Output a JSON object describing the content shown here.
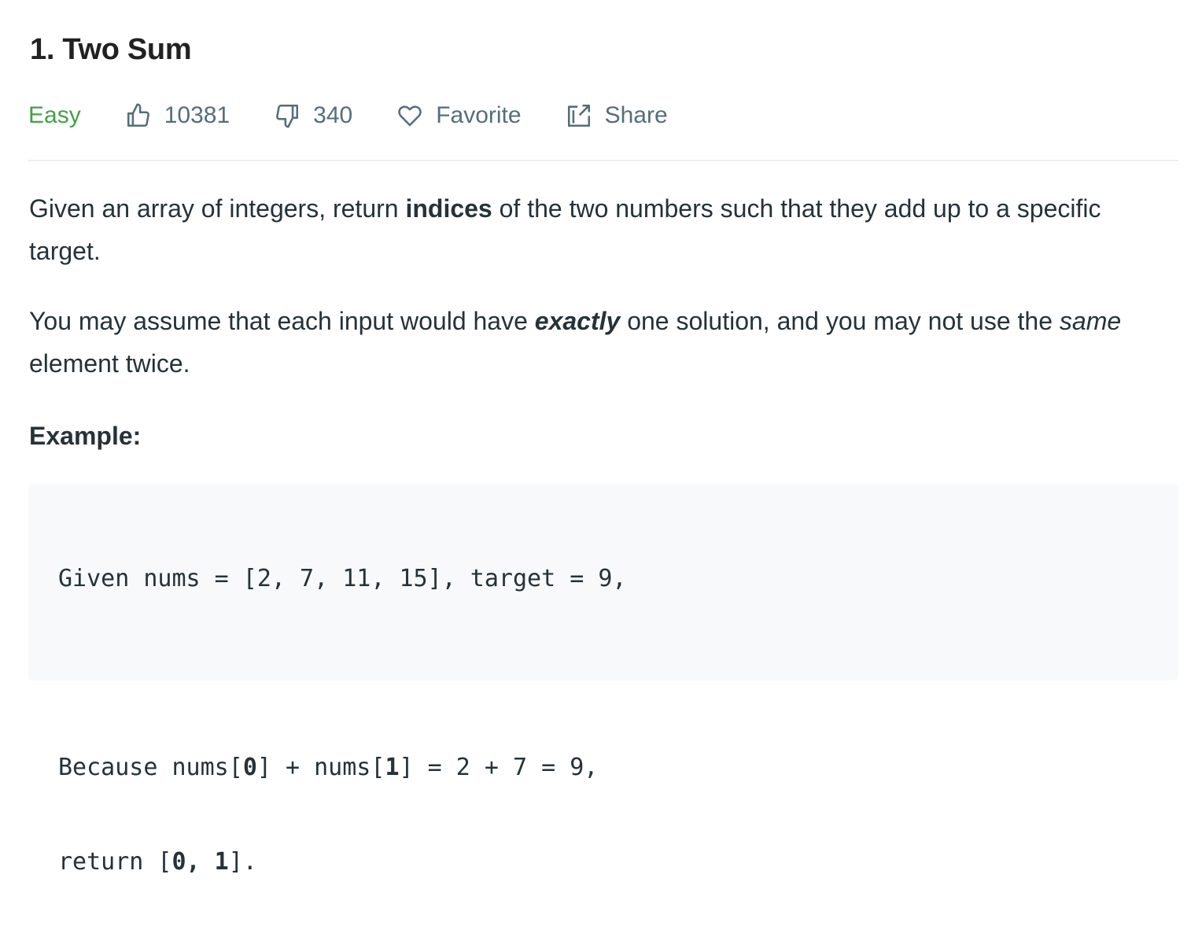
{
  "problem": {
    "title": "1. Two Sum",
    "difficulty": "Easy",
    "likes": "10381",
    "dislikes": "340",
    "favorite_label": "Favorite",
    "share_label": "Share"
  },
  "description": {
    "p1_part1": "Given an array of integers, return ",
    "p1_bold": "indices",
    "p1_part2": " of the two numbers such that they add up to a specific target.",
    "p2_part1": "You may assume that each input would have ",
    "p2_bold_italic": "exactly",
    "p2_part2": " one solution, and you may not use the ",
    "p2_italic": "same",
    "p2_part3": " element twice."
  },
  "example": {
    "heading": "Example:",
    "line1": "Given nums = [2, 7, 11, 15], target = 9,",
    "line2_a": "Because nums[",
    "line2_b": "0",
    "line2_c": "] + nums[",
    "line2_d": "1",
    "line2_e": "] = 2 + 7 = 9,",
    "line3_a": "return [",
    "line3_b": "0, 1",
    "line3_c": "]."
  },
  "colors": {
    "difficulty_easy": "#43a047",
    "meta_text": "#546e7a",
    "code_background": "#f7f9fa"
  },
  "icons": [
    "thumbs-up-icon",
    "thumbs-down-icon",
    "heart-icon",
    "share-icon"
  ]
}
